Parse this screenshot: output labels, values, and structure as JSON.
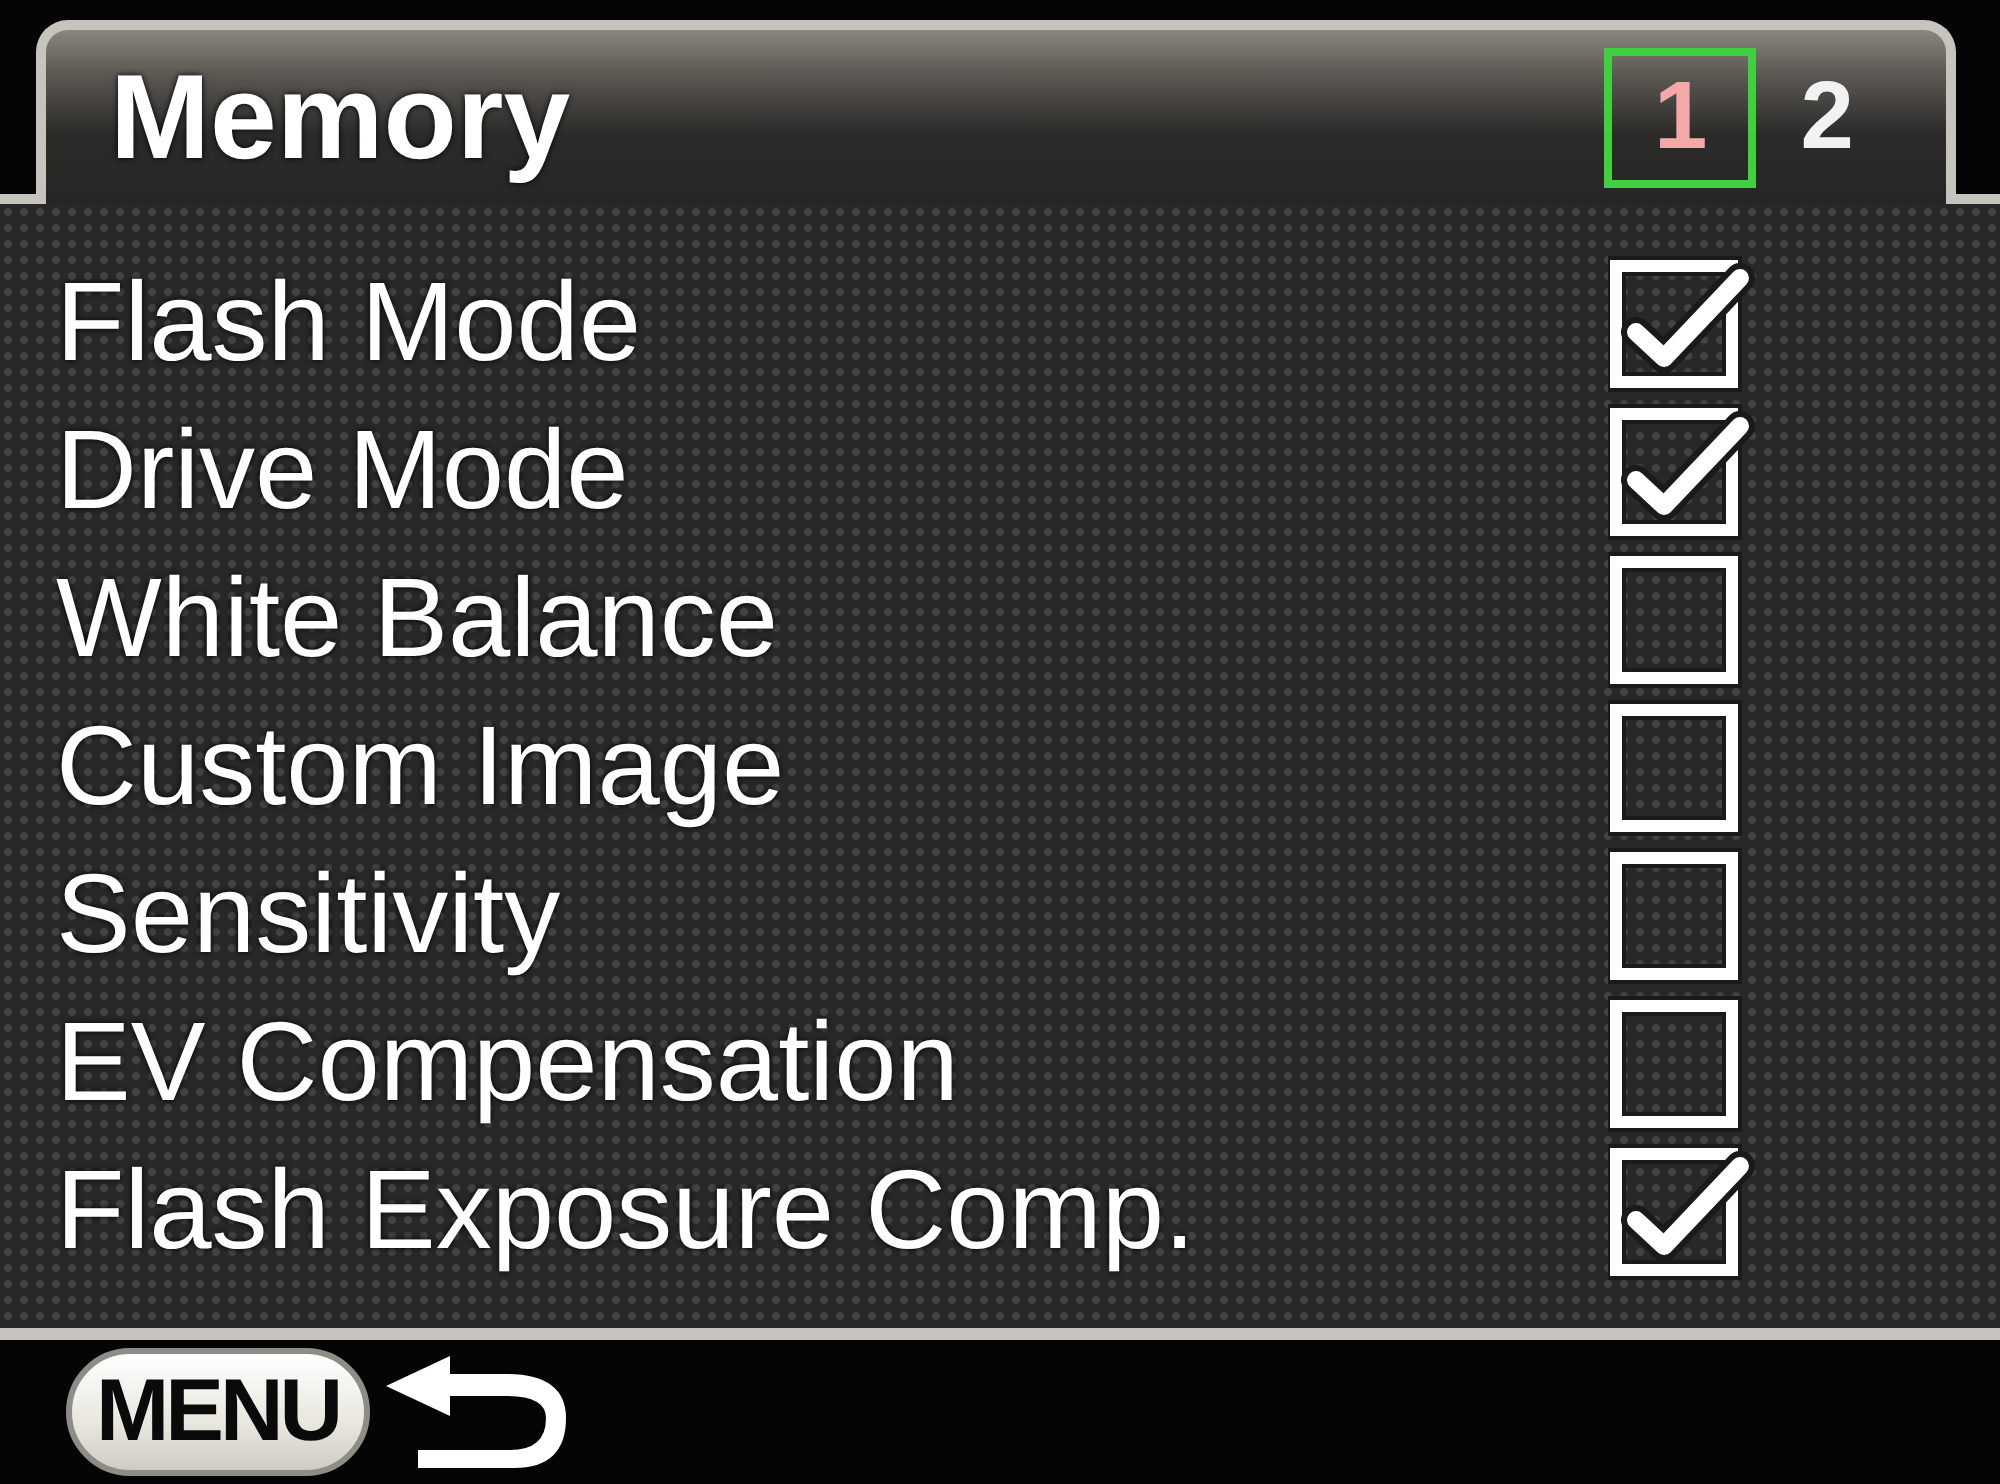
{
  "header": {
    "title": "Memory",
    "pages": [
      {
        "label": "1",
        "selected": true
      },
      {
        "label": "2",
        "selected": false
      }
    ]
  },
  "items": [
    {
      "label": "Flash Mode",
      "checked": true
    },
    {
      "label": "Drive Mode",
      "checked": true
    },
    {
      "label": "White Balance",
      "checked": false
    },
    {
      "label": "Custom Image",
      "checked": false
    },
    {
      "label": "Sensitivity",
      "checked": false
    },
    {
      "label": "EV Compensation",
      "checked": false
    },
    {
      "label": "Flash Exposure Comp.",
      "checked": true
    }
  ],
  "footer": {
    "key_label": "MENU"
  }
}
